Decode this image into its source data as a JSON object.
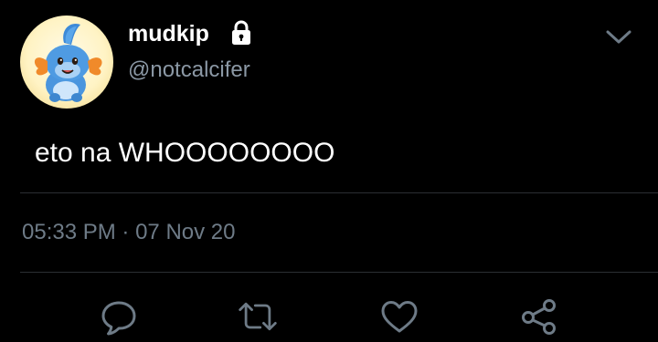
{
  "user": {
    "display_name": "mudkip",
    "handle": "@notcalcifer",
    "protected": true
  },
  "tweet": {
    "text": "eto na WHOOOOOOOO",
    "timestamp": "05:33 PM",
    "separator": "·",
    "date": "07 Nov 20"
  },
  "actions": {
    "icons": [
      "reply-icon",
      "retweet-icon",
      "like-icon",
      "share-icon"
    ]
  },
  "colors": {
    "background": "#000000",
    "primary_text": "#ffffff",
    "secondary_text": "#8b98a5",
    "icon": "#6e7b87",
    "divider": "#2b2f33"
  }
}
